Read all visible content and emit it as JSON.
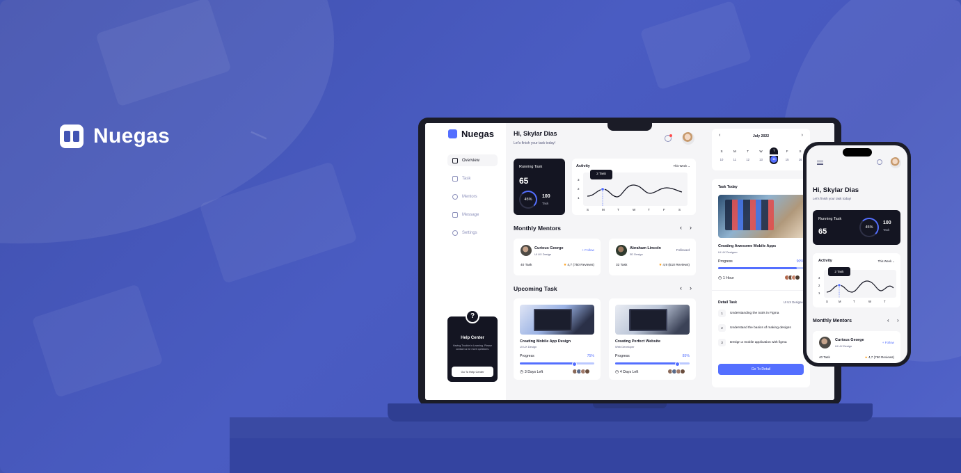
{
  "brand": {
    "name": "Nuegas"
  },
  "laptop": {
    "logo": "Nuegas",
    "nav": [
      {
        "label": "Overview",
        "icon": "grid-icon",
        "active": true
      },
      {
        "label": "Task",
        "icon": "book-icon",
        "active": false
      },
      {
        "label": "Mentors",
        "icon": "user-icon",
        "active": false
      },
      {
        "label": "Message",
        "icon": "message-icon",
        "active": false
      },
      {
        "label": "Settings",
        "icon": "gear-icon",
        "active": false
      }
    ],
    "help": {
      "mark": "?",
      "title": "Help Center",
      "desc": "Having Trouble in Learning. Please contact us for more questions.",
      "button": "Go To Help Center"
    },
    "greeting": "Hi, Skylar Dias",
    "greeting_sub": "Let's finish your task today!",
    "running": {
      "label": "Running Task",
      "value": "65",
      "percent": "45%",
      "total": "100",
      "total_label": "Task"
    },
    "activity": {
      "label": "Activity",
      "period": "This Week",
      "tooltip": "2 Task",
      "y_ticks": [
        "3",
        "2",
        "1"
      ],
      "days": [
        "S",
        "M",
        "T",
        "W",
        "T",
        "F",
        "S"
      ]
    },
    "mentors_title": "Monthly Mentors",
    "mentors": [
      {
        "name": "Curious George",
        "role": "UI UX Design",
        "follow": "+ Follow",
        "tasks": "40 Task",
        "rating": "4,7 (750 Reviews)"
      },
      {
        "name": "Abraham Lincoln",
        "role": "3D Design",
        "follow": "Followed",
        "tasks": "32 Task",
        "rating": "4,9 (510 Reviews)"
      }
    ],
    "upcoming_title": "Upcoming Task",
    "tasks": [
      {
        "title": "Creating Mobile App Design",
        "sub": "UI UX Design",
        "progress_label": "Progress",
        "progress": "75%",
        "progress_value": 0.75,
        "deadline": "3 Days Left"
      },
      {
        "title": "Creating Perfect Website",
        "sub": "Web Developer",
        "progress_label": "Progress",
        "progress": "85%",
        "progress_value": 0.85,
        "deadline": "4 Days Left"
      }
    ],
    "calendar": {
      "month": "July 2022",
      "days": [
        "S",
        "M",
        "T",
        "W",
        "T",
        "F",
        "S"
      ],
      "dates": [
        "10",
        "11",
        "12",
        "13",
        "14",
        "15",
        "16"
      ],
      "selected_index": 4
    },
    "task_today": {
      "label": "Task Today",
      "title": "Creating Awesome Mobile Apps",
      "sub": "UI UX Designer",
      "progress_label": "Progress",
      "progress": "90%",
      "progress_value": 0.9,
      "time": "1 Hour",
      "detail_title": "Detail Task",
      "detail_role": "UI UX Designer",
      "steps": [
        {
          "n": "1",
          "text": "Understanding the tools in Figma"
        },
        {
          "n": "2",
          "text": "Understand the basics of making designs"
        },
        {
          "n": "3",
          "text": "Design a mobile application with figma"
        }
      ],
      "button": "Go To Detail"
    }
  },
  "phone": {
    "greeting": "Hi, Skylar Dias",
    "greeting_sub": "Let's finish your task today!",
    "running": {
      "label": "Running Task",
      "value": "65",
      "percent": "45%",
      "total": "100",
      "total_label": "Task"
    },
    "activity": {
      "label": "Activity",
      "period": "This Week",
      "tooltip": "2 Task",
      "y_ticks": [
        "3",
        "2",
        "1"
      ],
      "days": [
        "S",
        "M",
        "T",
        "W",
        "T"
      ]
    },
    "mentors_title": "Monthly Mentors",
    "mentor": {
      "name": "Curious George",
      "role": "UI UX Design",
      "follow": "+ Follow",
      "tasks": "40 Task",
      "rating": "4,7 (750 Reviews)"
    }
  },
  "colors": {
    "accent": "#546fff",
    "dark": "#141522",
    "background": "#4254b3"
  }
}
